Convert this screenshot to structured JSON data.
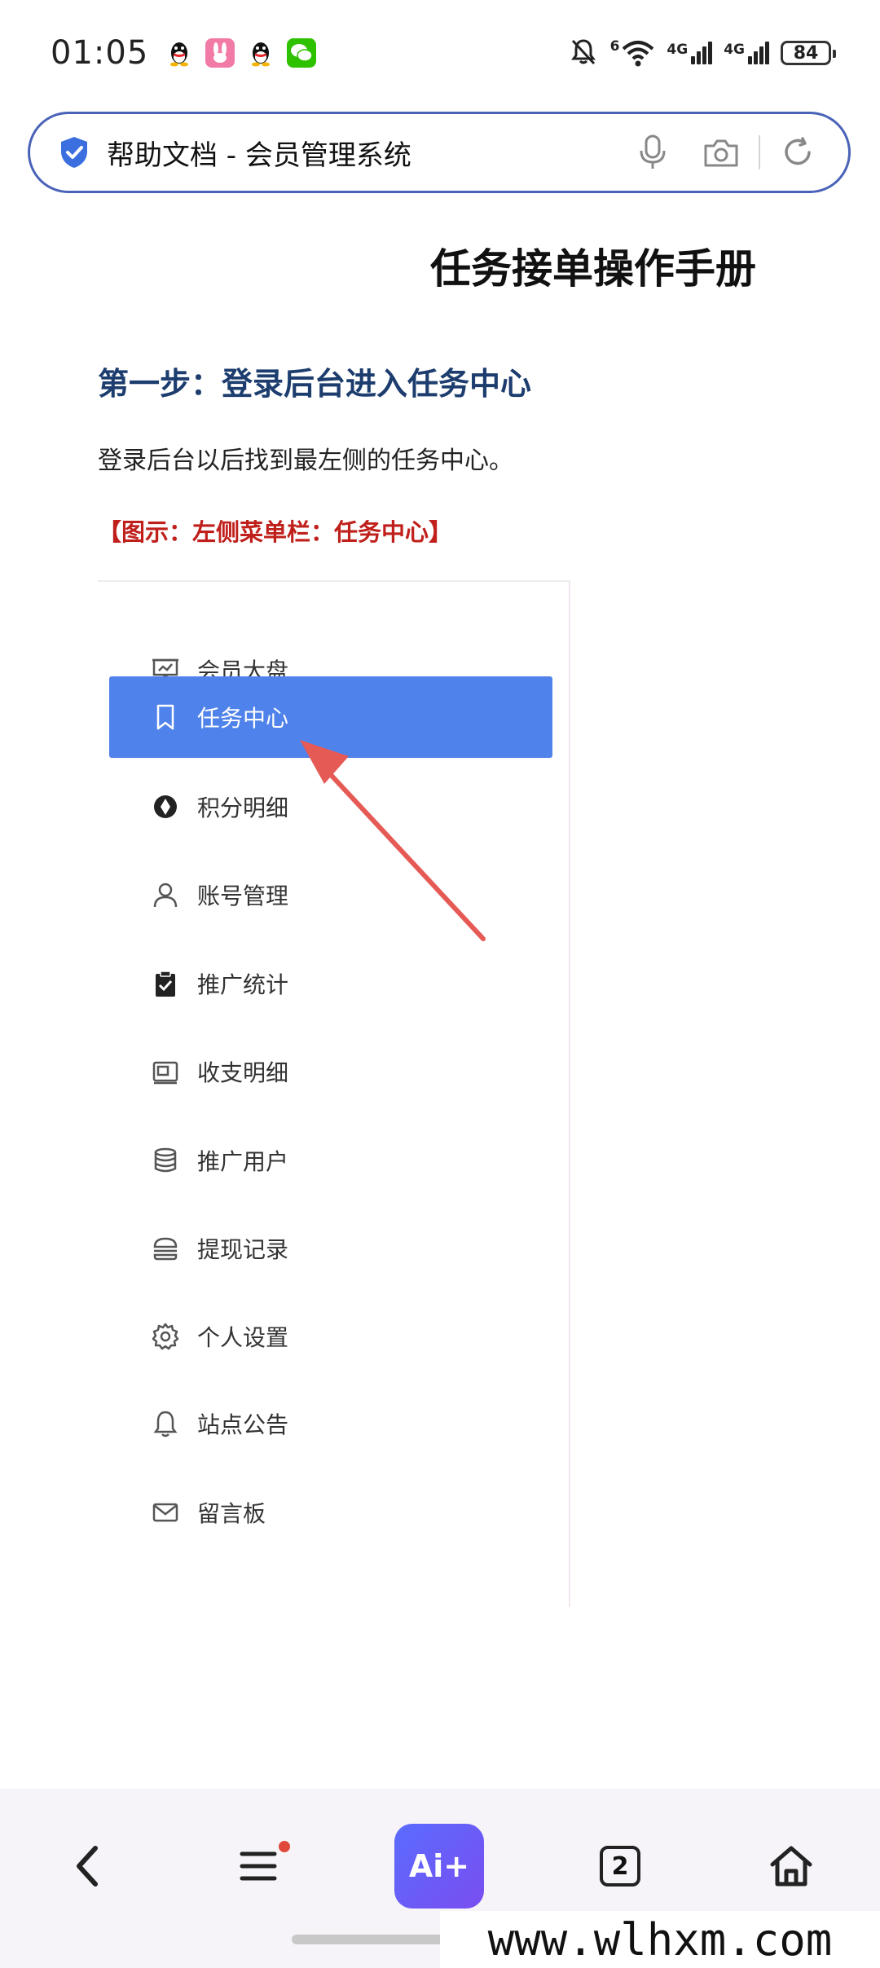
{
  "status_bar": {
    "time": "01:05",
    "signal_label_1": "4G",
    "signal_label_2": "4G",
    "wifi_label": "6",
    "battery": "84"
  },
  "address_bar": {
    "text": "帮助文档 - 会员管理系统",
    "shield_color": "#3b6fe0"
  },
  "document": {
    "title": "任务接单操作手册",
    "step_heading": "第一步：登录后台进入任务中心",
    "step_desc": "登录后台以后找到最左侧的任务中心。",
    "figure_caption": "【图示：左侧菜单栏：任务中心】"
  },
  "menu": {
    "items": [
      {
        "label": "会员大盘",
        "icon": "presentation-board-icon"
      },
      {
        "label": "任务中心",
        "icon": "bookmark-icon",
        "active": true
      },
      {
        "label": "积分明细",
        "icon": "aperture-icon"
      },
      {
        "label": "账号管理",
        "icon": "user-icon"
      },
      {
        "label": "推广统计",
        "icon": "clipboard-check-icon"
      },
      {
        "label": "收支明细",
        "icon": "wallet-icon"
      },
      {
        "label": "推广用户",
        "icon": "database-icon"
      },
      {
        "label": "提现记录",
        "icon": "burger-icon"
      },
      {
        "label": "个人设置",
        "icon": "gear-icon"
      },
      {
        "label": "站点公告",
        "icon": "bell-icon"
      },
      {
        "label": "留言板",
        "icon": "mail-icon"
      }
    ],
    "active_color": "#4f82ea",
    "arrow_color": "#e55a55"
  },
  "bottom_nav": {
    "ai_label": "Ai+",
    "tab_count": "2"
  },
  "watermark": "www.wlhxm.com"
}
